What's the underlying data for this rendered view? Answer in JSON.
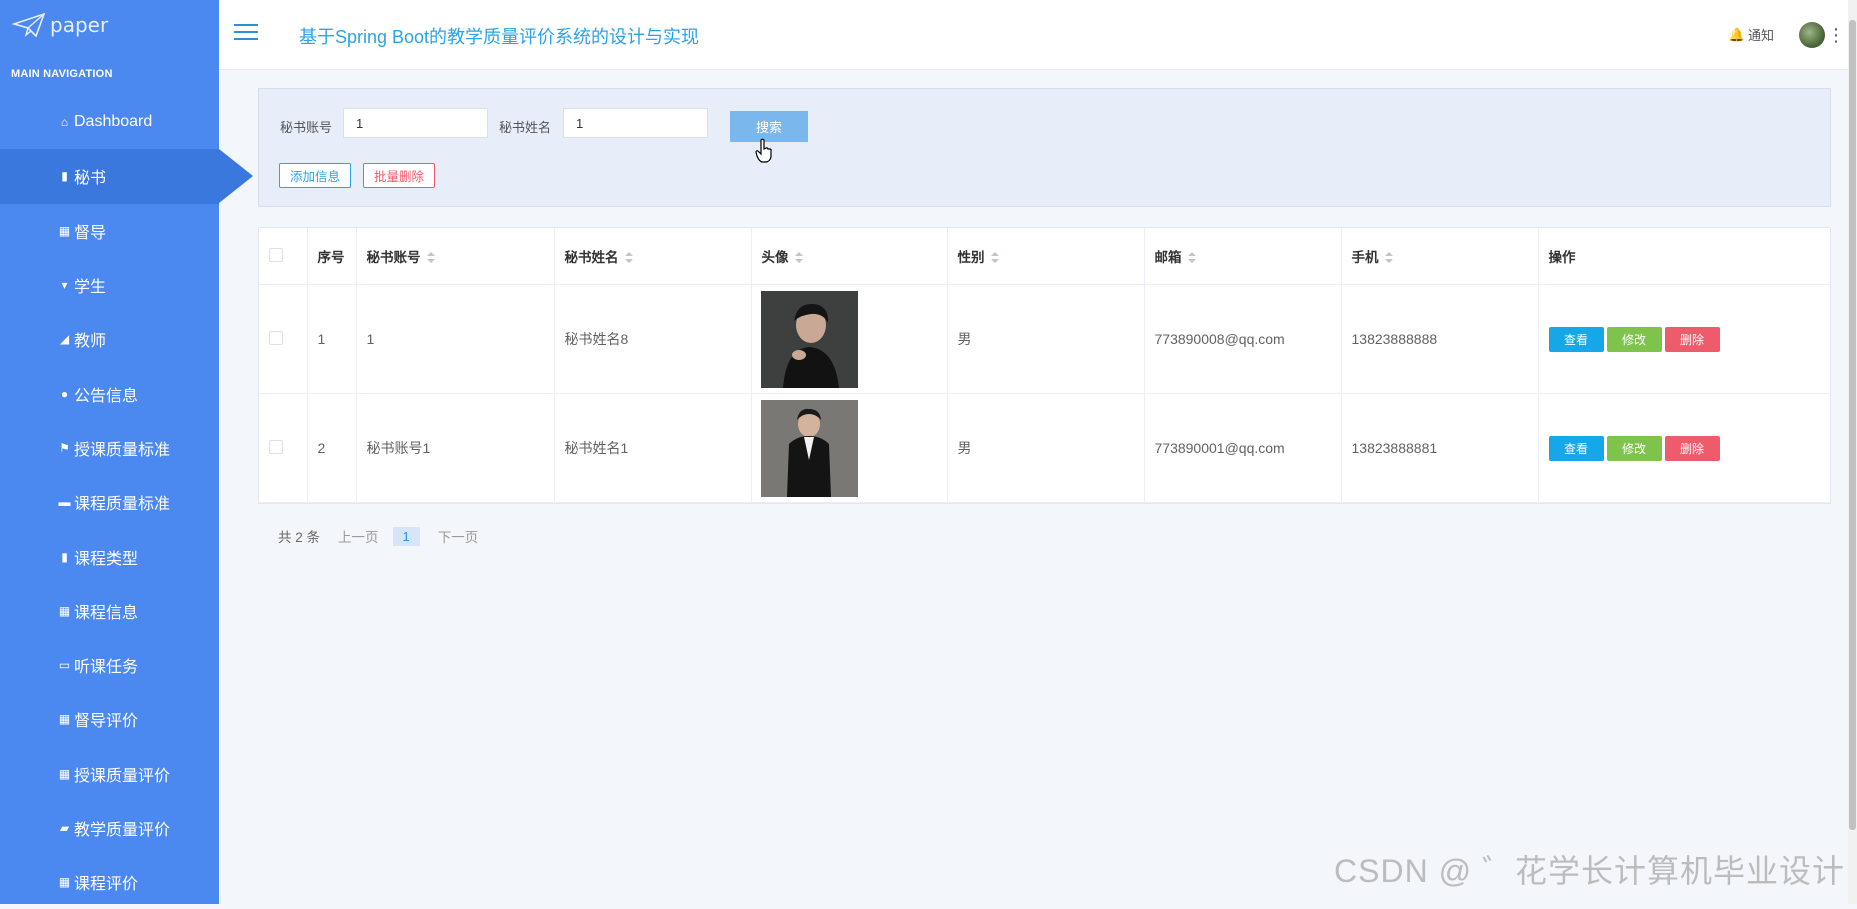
{
  "brand": {
    "name": "paper"
  },
  "sidebar": {
    "section_title": "MAIN NAVIGATION",
    "items": [
      {
        "label": "Dashboard",
        "icon": "home-icon",
        "glyph": "⌂"
      },
      {
        "label": "秘书",
        "icon": "clipboard-icon",
        "glyph": "▮",
        "active": true
      },
      {
        "label": "督导",
        "icon": "grid-icon",
        "glyph": "▦"
      },
      {
        "label": "学生",
        "icon": "badge-icon",
        "glyph": "▾"
      },
      {
        "label": "教师",
        "icon": "thumb-icon",
        "glyph": "◢"
      },
      {
        "label": "公告信息",
        "icon": "user-icon",
        "glyph": "●"
      },
      {
        "label": "授课质量标准",
        "icon": "flag-icon",
        "glyph": "⚑"
      },
      {
        "label": "课程质量标准",
        "icon": "ticket-icon",
        "glyph": "▬"
      },
      {
        "label": "课程类型",
        "icon": "bar-chart-icon",
        "glyph": "▮"
      },
      {
        "label": "课程信息",
        "icon": "grid-icon",
        "glyph": "▦"
      },
      {
        "label": "听课任务",
        "icon": "briefcase-icon",
        "glyph": "▭"
      },
      {
        "label": "督导评价",
        "icon": "grid-icon",
        "glyph": "▦"
      },
      {
        "label": "授课质量评价",
        "icon": "grid-icon",
        "glyph": "▦"
      },
      {
        "label": "教学质量评价",
        "icon": "comment-icon",
        "glyph": "▰"
      },
      {
        "label": "课程评价",
        "icon": "grid-icon",
        "glyph": "▦"
      }
    ]
  },
  "header": {
    "title": "基于Spring Boot的教学质量评价系统的设计与实现",
    "notify_label": "通知"
  },
  "search": {
    "account_label": "秘书账号",
    "account_value": "1",
    "name_label": "秘书姓名",
    "name_value": "1",
    "search_button": "搜索",
    "add_button": "添加信息",
    "batch_delete_button": "批量删除"
  },
  "table": {
    "columns": [
      "序号",
      "秘书账号",
      "秘书姓名",
      "头像",
      "性别",
      "邮箱",
      "手机",
      "操作"
    ],
    "rows": [
      {
        "index": "1",
        "account": "1",
        "name": "秘书姓名8",
        "gender": "男",
        "email": "773890008@qq.com",
        "phone": "13823888888"
      },
      {
        "index": "2",
        "account": "秘书账号1",
        "name": "秘书姓名1",
        "gender": "男",
        "email": "773890001@qq.com",
        "phone": "13823888881"
      }
    ],
    "actions": {
      "view": "查看",
      "edit": "修改",
      "delete": "删除"
    }
  },
  "pagination": {
    "total": "共 2 条",
    "prev": "上一页",
    "current": "1",
    "next": "下一页"
  },
  "watermark": "CSDN @ ゛花学长计算机毕业设计",
  "colors": {
    "sidebar": "#4b89f1",
    "accent": "#2ba3e8",
    "view": "#16a7e9",
    "edit": "#7ec44c",
    "delete": "#ee5c6c"
  }
}
